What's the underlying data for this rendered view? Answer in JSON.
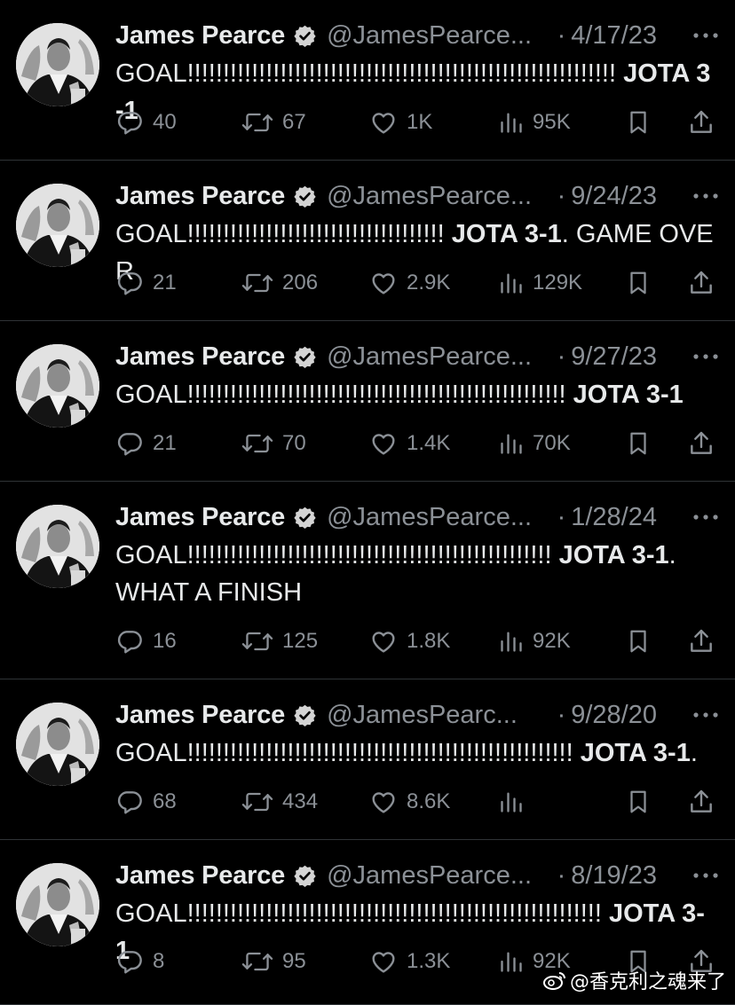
{
  "author": {
    "name": "James Pearce",
    "verified": true,
    "handle_full": "@JamesPearceLFC"
  },
  "colors": {
    "background": "#000000",
    "text": "#e7e9ea",
    "muted": "#8b9096",
    "divider": "#2f3336"
  },
  "icons": [
    "reply-icon",
    "retweet-icon",
    "like-icon",
    "views-icon",
    "bookmark-icon",
    "share-icon",
    "more-icon",
    "verified-badge-icon"
  ],
  "tweets": [
    {
      "handle": "@JamesPearce...",
      "date": "4/17/23",
      "text_prefix": "GOAL!!!!!!!!!!!!!!!!!!!!!!!!!!!!!!!!!!!!!!!!!!!!!!!!!!!!!!!!!!!! ",
      "text_bold": "JOTA 3-1",
      "text_suffix": "",
      "replies": "40",
      "retweets": "67",
      "likes": "1K",
      "views": "95K"
    },
    {
      "handle": "@JamesPearce...",
      "date": "9/24/23",
      "text_prefix": "GOAL!!!!!!!!!!!!!!!!!!!!!!!!!!!!!!!!!!!! ",
      "text_bold": "JOTA 3-1",
      "text_suffix": ". GAME OVER",
      "replies": "21",
      "retweets": "206",
      "likes": "2.9K",
      "views": "129K"
    },
    {
      "handle": "@JamesPearce...",
      "date": "9/27/23",
      "text_prefix": "GOAL!!!!!!!!!!!!!!!!!!!!!!!!!!!!!!!!!!!!!!!!!!!!!!!!!!!!! ",
      "text_bold": "JOTA 3-1",
      "text_suffix": "",
      "replies": "21",
      "retweets": "70",
      "likes": "1.4K",
      "views": "70K"
    },
    {
      "handle": "@JamesPearce...",
      "date": "1/28/24",
      "text_prefix": "GOAL!!!!!!!!!!!!!!!!!!!!!!!!!!!!!!!!!!!!!!!!!!!!!!!!!!! ",
      "text_bold": "JOTA 3-1",
      "text_suffix": ".\nWHAT A FINISH",
      "replies": "16",
      "retweets": "125",
      "likes": "1.8K",
      "views": "92K"
    },
    {
      "handle": "@JamesPearc...",
      "date": "9/28/20",
      "text_prefix": "GOAL!!!!!!!!!!!!!!!!!!!!!!!!!!!!!!!!!!!!!!!!!!!!!!!!!!!!!! ",
      "text_bold": "JOTA 3-1",
      "text_suffix": ".",
      "replies": "68",
      "retweets": "434",
      "likes": "8.6K",
      "views": ""
    },
    {
      "handle": "@JamesPearce...",
      "date": "8/19/23",
      "text_prefix": "GOAL!!!!!!!!!!!!!!!!!!!!!!!!!!!!!!!!!!!!!!!!!!!!!!!!!!!!!!!!!! ",
      "text_bold": "JOTA 3-1",
      "text_suffix": "",
      "replies": "8",
      "retweets": "95",
      "likes": "1.3K",
      "views": "92K"
    }
  ],
  "watermark": {
    "text": "@香克利之魂来了",
    "icon": "weibo-icon"
  }
}
